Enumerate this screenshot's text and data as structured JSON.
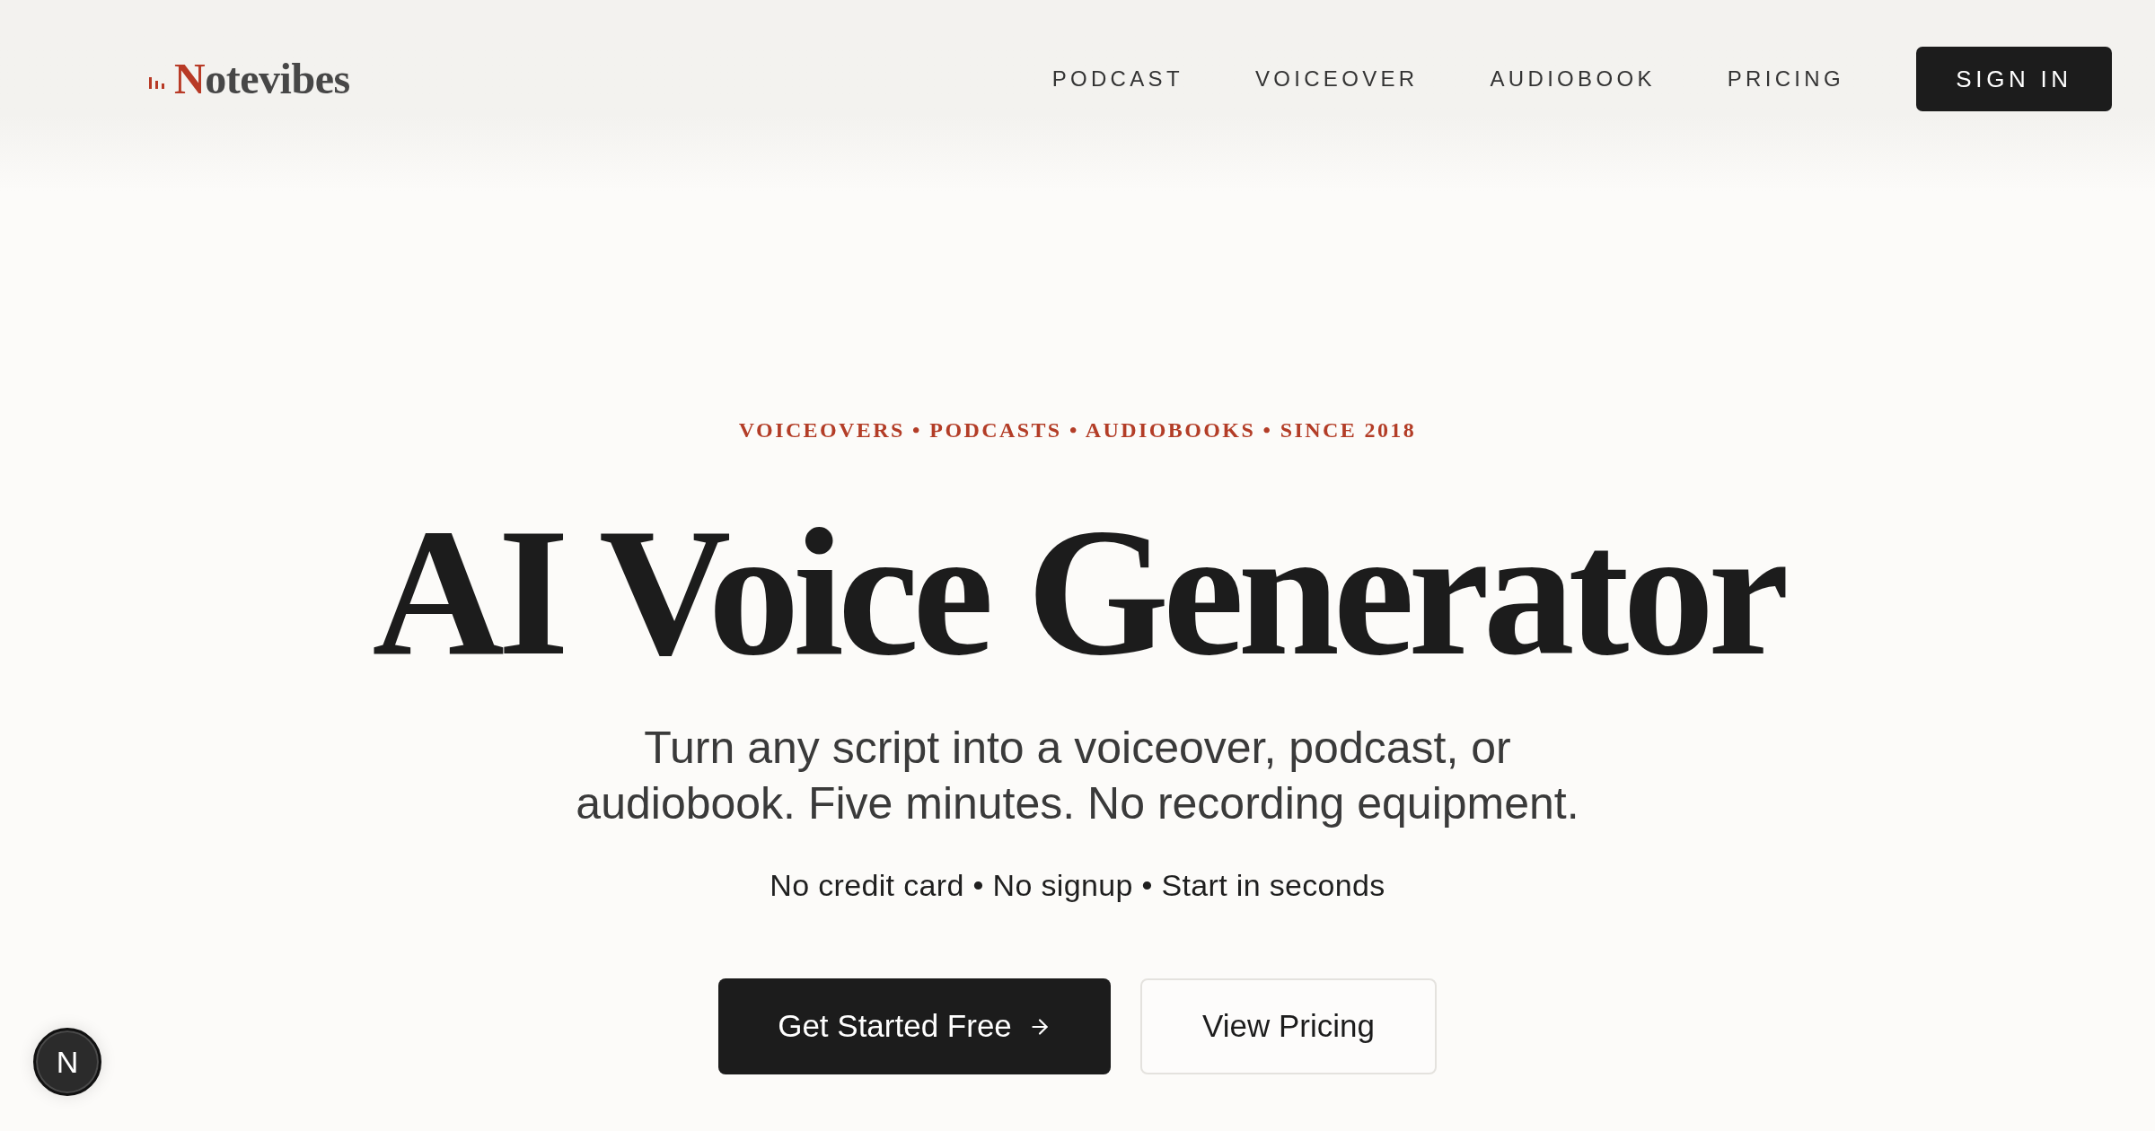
{
  "header": {
    "logo": {
      "wordmark": "Notevibes"
    },
    "nav": [
      "PODCAST",
      "VOICEOVER",
      "AUDIOBOOK",
      "PRICING"
    ],
    "sign_in": "SIGN IN"
  },
  "hero": {
    "eyebrow": "VOICEOVERS • PODCASTS • AUDIOBOOKS • SINCE 2018",
    "title": "AI Voice Generator",
    "subtitle": "Turn any script into a voiceover, podcast, or audiobook. Five minutes. No recording equipment.",
    "perks": "No credit card • No signup • Start in seconds",
    "buttons": [
      {
        "label": "Get Started Free",
        "kind": "primary"
      },
      {
        "label": "View Pricing",
        "kind": "secondary"
      }
    ]
  },
  "dev_badge": {
    "label": "N"
  }
}
